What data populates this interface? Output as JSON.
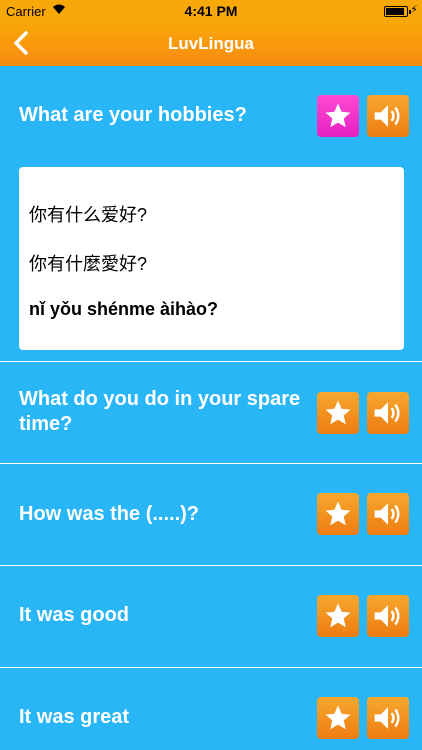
{
  "status_bar": {
    "carrier": "Carrier",
    "time": "4:41 PM",
    "battery_level": 0.9
  },
  "nav": {
    "title": "LuvLingua"
  },
  "phrases": [
    {
      "text": "What are your hobbies?",
      "favorited": true,
      "translations": {
        "simplified": "你有什么爱好?",
        "traditional": "你有什麼愛好?",
        "pinyin": "nǐ yǒu shénme àihào?"
      }
    },
    {
      "text_line1": "What do you do in your spare",
      "text_line2": "time?",
      "favorited": false
    },
    {
      "text": "How was the (.....)?",
      "favorited": false
    },
    {
      "text": "It was good",
      "favorited": false
    },
    {
      "text": "It was great",
      "favorited": false
    }
  ],
  "colors": {
    "background": "#29b6f6",
    "header": "#f9a80a",
    "star_active": "#f73fd4",
    "button": "#f39a1f"
  },
  "icons": {
    "back": "chevron-left-icon",
    "star": "star-icon",
    "sound": "speaker-icon"
  }
}
